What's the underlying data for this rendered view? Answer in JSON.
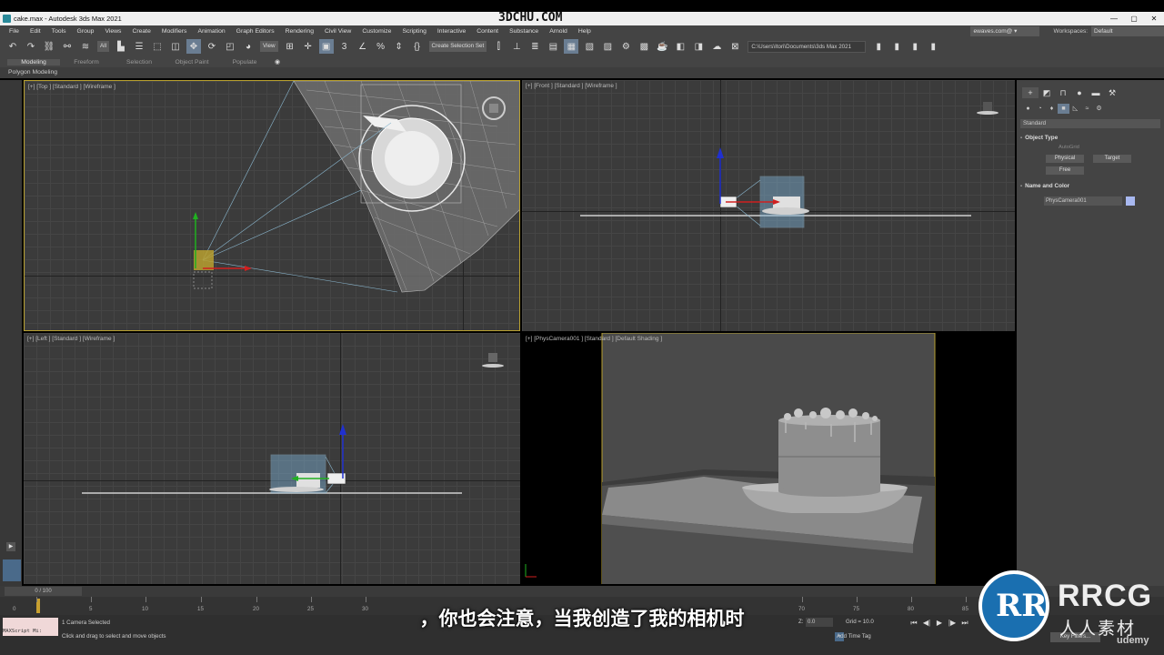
{
  "window": {
    "title": "cake.max - Autodesk 3ds Max 2021",
    "logo": "3DCHU.COM",
    "controls": [
      "—",
      "▢",
      "✕"
    ]
  },
  "menu": {
    "items": [
      "File",
      "Edit",
      "Tools",
      "Group",
      "Views",
      "Create",
      "Modifiers",
      "Animation",
      "Graph Editors",
      "Rendering",
      "Civil View",
      "Customize",
      "Scripting",
      "Interactive",
      "Content",
      "Substance",
      "Arnold",
      "Help"
    ],
    "account": "ewaves.com@ ▾",
    "workspaces_label": "Workspaces:",
    "workspaces_value": "Default"
  },
  "toolbar": {
    "selection_filter": "All",
    "reference_coord": "View",
    "named_selection": "Create Selection Set",
    "project_path": "C:\\Users\\Itori\\Documents\\3ds Max 2021",
    "icons": [
      "undo-icon",
      "redo-icon",
      "link-icon",
      "unlink-icon",
      "bind-space-warp-icon",
      "select-object-icon",
      "select-by-name-icon",
      "rect-selection-icon",
      "window-crossing-icon",
      "move-icon",
      "rotate-icon",
      "scale-icon",
      "placement-icon",
      "pivot-icon",
      "snaps-icon",
      "angle-snap-icon",
      "percent-snap-icon",
      "spinner-snap-icon",
      "edit-named-sets-icon",
      "mirror-icon",
      "align-icon",
      "layer-explorer-icon",
      "toggle-ribbon-icon",
      "curve-editor-icon",
      "schematic-view-icon",
      "material-editor-icon",
      "render-setup-icon",
      "rendered-frame-icon",
      "render-icon"
    ]
  },
  "ribbon": {
    "tabs": [
      "Modeling",
      "Freeform",
      "Selection",
      "Object Paint",
      "Populate"
    ],
    "active_tab": "Modeling",
    "panel_label": "Polygon Modeling"
  },
  "viewports": {
    "top": "[+] [Top ] [Standard ] [Wireframe ]",
    "front": "[+] [Front ] [Standard ] [Wireframe ]",
    "left": "[+] [Left ] [Standard ] [Wireframe ]",
    "camera": "[+] [PhysCamera001 ] [Standard ] [Default Shading ]"
  },
  "command_panel": {
    "category_dropdown": "Standard",
    "object_type_header": "Object Type",
    "autogrid_label": "AutoGrid",
    "buttons": [
      "Physical",
      "Target",
      "Free"
    ],
    "name_color_header": "Name and Color",
    "object_name": "PhysCamera001",
    "swatch_color": "#a8b8f0"
  },
  "timeline": {
    "frame_display": "0 / 100",
    "ticks": [
      "0",
      "5",
      "10",
      "15",
      "20",
      "25",
      "30",
      "70",
      "75",
      "80",
      "85"
    ],
    "current_frame": 0
  },
  "status": {
    "maxscript_label": "MAXScript Mi:",
    "selection": "1 Camera Selected",
    "prompt": "Click and drag to select and move objects",
    "z_label": "Z:",
    "z_value": "0.0",
    "grid": "Grid = 10.0",
    "add_time_tag": "Add Time Tag",
    "key_filters": "Key Filters...",
    "playback": [
      "⏮",
      "◀|",
      "▶",
      "|▶",
      "⏭"
    ]
  },
  "subtitle": "，你也会注意，当我创造了我的相机时",
  "watermark": {
    "mark": "RR",
    "brand": "RRCG",
    "brand_cn": "人人素材",
    "udemy": "udemy"
  },
  "colors": {
    "accent_active": "#6a7d92",
    "viewport_border": "#b8a030",
    "axis_x": "#d02020",
    "axis_y": "#20b020",
    "axis_z": "#2030d0",
    "gizmo_box": "#7fb4d8"
  }
}
